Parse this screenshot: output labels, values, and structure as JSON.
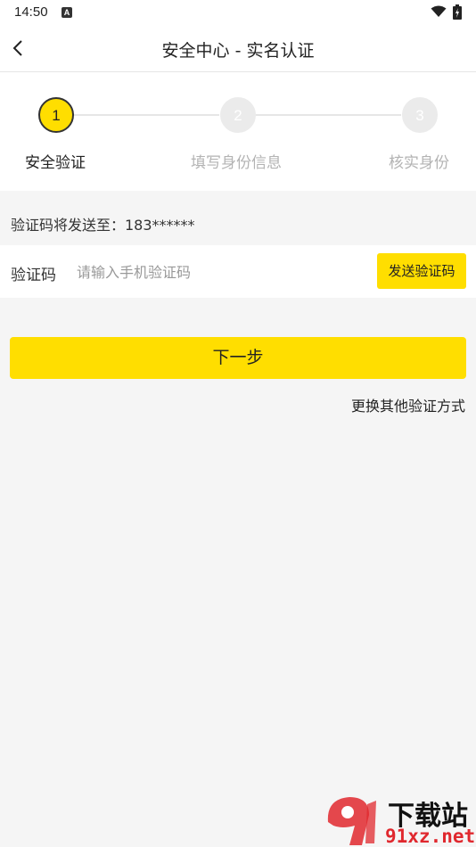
{
  "status_bar": {
    "time": "14:50",
    "notification_letter": "A"
  },
  "header": {
    "title": "安全中心 - 实名认证"
  },
  "steps": [
    {
      "number": "1",
      "label": "安全验证",
      "active": true
    },
    {
      "number": "2",
      "label": "填写身份信息",
      "active": false
    },
    {
      "number": "3",
      "label": "核实身份",
      "active": false
    }
  ],
  "notice": {
    "text": "验证码将发送至：183******"
  },
  "code_field": {
    "label": "验证码",
    "placeholder": "请输入手机验证码",
    "value": "",
    "send_label": "发送验证码"
  },
  "next_button": {
    "label": "下一步"
  },
  "alt_method": {
    "label": "更换其他验证方式"
  },
  "watermark": {
    "line1": "下载站",
    "line2": "91xz.net"
  },
  "colors": {
    "accent": "#ffde00",
    "background": "#f5f5f5",
    "inactive_text": "#b3b3b3"
  }
}
